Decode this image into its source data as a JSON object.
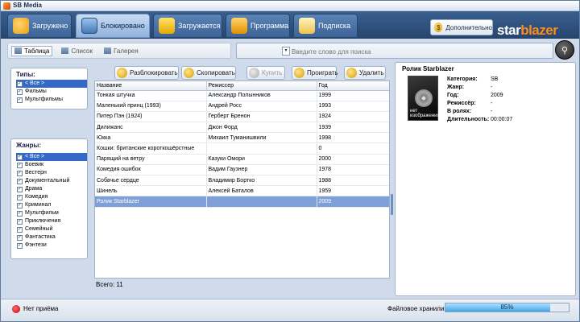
{
  "window": {
    "title": "SB Media"
  },
  "nav": {
    "tabs": [
      {
        "label": "Загружено",
        "icon": "downloaded-icon"
      },
      {
        "label": "Блокировано",
        "icon": "blocked-icon"
      },
      {
        "label": "Загружается",
        "icon": "loading-icon"
      },
      {
        "label": "Программа",
        "icon": "program-icon"
      },
      {
        "label": "Подписка",
        "icon": "subscribe-icon"
      }
    ],
    "active_tab": "Блокировано",
    "extra_label": "Дополнительно",
    "logo_part1": "star",
    "logo_part2": "blazer"
  },
  "view": {
    "items": [
      "Таблица",
      "Список",
      "Галерея"
    ],
    "active": "Таблица"
  },
  "search": {
    "placeholder": "Введите слово для поиска",
    "dropdown": "▾"
  },
  "types": {
    "title": "Типы:",
    "items": [
      {
        "label": "< Все >",
        "checked": true,
        "selected": true
      },
      {
        "label": "Фильмы",
        "checked": true
      },
      {
        "label": "Мультфильмы",
        "checked": true
      }
    ]
  },
  "genres": {
    "title": "Жанры:",
    "items": [
      {
        "label": "< Все >",
        "checked": true,
        "selected": true
      },
      {
        "label": "Боевик",
        "checked": true
      },
      {
        "label": "Вестерн",
        "checked": true
      },
      {
        "label": "Документальный",
        "checked": true
      },
      {
        "label": "Драма",
        "checked": true
      },
      {
        "label": "Комедия",
        "checked": true
      },
      {
        "label": "Криминал",
        "checked": true
      },
      {
        "label": "Мультфильм",
        "checked": true
      },
      {
        "label": "Приключения",
        "checked": true
      },
      {
        "label": "Семейный",
        "checked": true
      },
      {
        "label": "Фантастика",
        "checked": true
      },
      {
        "label": "Фэнтези",
        "checked": true
      }
    ]
  },
  "actions": {
    "unblock": "Разблокировать",
    "copy": "Скопировать",
    "buy": "Купить",
    "play": "Проиграть",
    "delete": "Удалить"
  },
  "table": {
    "columns": [
      "Название",
      "Режиссер",
      "Год"
    ],
    "rows": [
      [
        "Тонкая штучка",
        "Александр Полынников",
        "1999"
      ],
      [
        "Маленький принц (1993)",
        "Андрей Росс",
        "1993"
      ],
      [
        "Питер Пэн (1924)",
        "Герберт Бренон",
        "1924"
      ],
      [
        "Дилижанс",
        "Джон Форд",
        "1939"
      ],
      [
        "Юкка",
        "Михаил Туманишвили",
        "1998"
      ],
      [
        "Кошки: британские короткошёрстные",
        "",
        "0"
      ],
      [
        "Парящий на ветру",
        "Казуки Омори",
        "2000"
      ],
      [
        "Комедия ошибок",
        "Вадим Гаузнер",
        "1978"
      ],
      [
        "Собачье сердце",
        "Владимир Бортко",
        "1988"
      ],
      [
        "Шинель",
        "Алексей Баталов",
        "1959"
      ],
      [
        "Ролик Starblazer",
        "",
        "2009"
      ]
    ],
    "selected_row": 10,
    "total_label": "Всего: 11"
  },
  "info": {
    "title": "Ролик Starblazer",
    "thumb_caption_1": "нет",
    "thumb_caption_2": "изображения",
    "props": [
      {
        "key": "Категория:",
        "value": "SB"
      },
      {
        "key": "Жанр:",
        "value": "-"
      },
      {
        "key": "Год:",
        "value": "2009"
      },
      {
        "key": "Режиссёр:",
        "value": "-"
      },
      {
        "key": "В ролях:",
        "value": "-"
      },
      {
        "key": "Длительность:",
        "value": "00:00:07"
      }
    ]
  },
  "status": {
    "connection": "Нет приёма",
    "storage_label": "Файловое хранилище:",
    "storage_percent": 85,
    "storage_text": "85%",
    "colors": {
      "offline": "#c30000",
      "accent": "#ff8c1a",
      "selection": "#3569c7"
    }
  }
}
